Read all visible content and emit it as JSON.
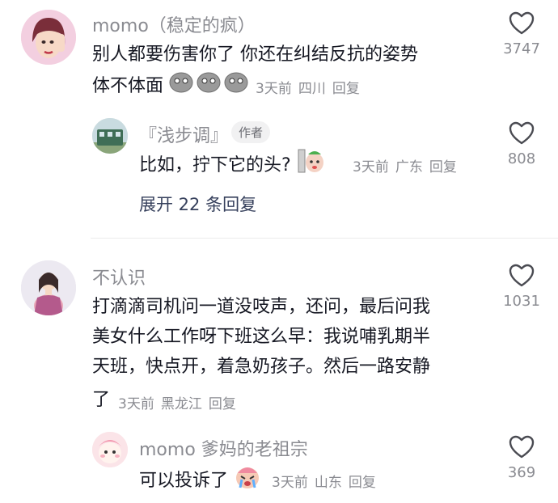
{
  "comments": [
    {
      "author": "momo（稳定的疯）",
      "lines": [
        "别人都要伤害你了 你还在纠结反抗的姿势",
        "体不体面"
      ],
      "time": "3天前",
      "location": "四川",
      "reply_label": "回复",
      "likes": "3747",
      "reply": {
        "author": "『浅步调』",
        "badge": "作者",
        "text": "比如，拧下它的头?",
        "time": "3天前",
        "location": "广东",
        "reply_label": "回复",
        "likes": "808"
      },
      "expand_label": "展开 22 条回复"
    },
    {
      "author": "不认识",
      "lines": [
        "打滴滴司机问一道没吱声，还问，最后问我",
        "美女什么工作呀下班这么早：我说哺乳期半",
        "天班，快点开，着急奶孩子。然后一路安静",
        "了"
      ],
      "time": "3天前",
      "location": "黑龙江",
      "reply_label": "回复",
      "likes": "1031",
      "reply": {
        "author": "momo 爹妈的老祖宗",
        "text": "可以投诉了",
        "time": "3天前",
        "location": "山东",
        "reply_label": "回复",
        "likes": "369"
      }
    }
  ],
  "colors": {
    "meta": "#8a8b91",
    "text": "#161823",
    "expand": "#36405c"
  }
}
